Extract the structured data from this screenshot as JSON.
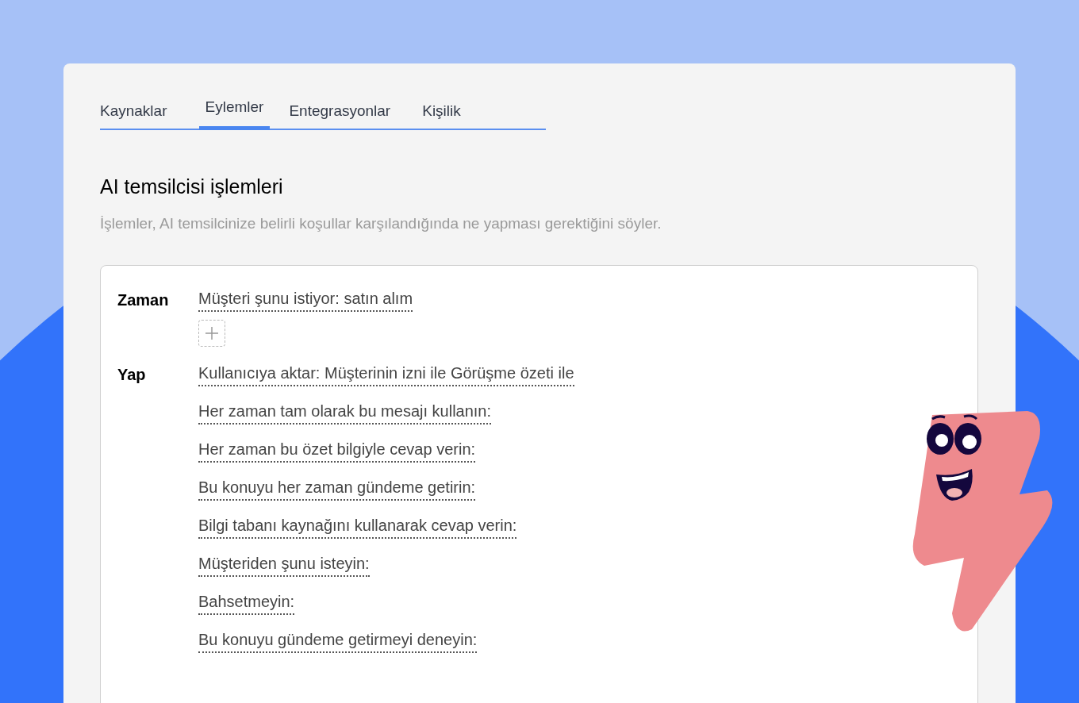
{
  "tabs": [
    {
      "label": "Kaynaklar",
      "selected": false
    },
    {
      "label": "Eylemler",
      "selected": true
    },
    {
      "label": "Entegrasyonlar",
      "selected": false
    },
    {
      "label": "Kişilik",
      "selected": false
    }
  ],
  "heading": "AI temsilcisi işlemleri",
  "description": "İşlemler, AI temsilcinize belirli koşullar karşılandığında ne yapması gerektiğini söyler.",
  "rules": [
    {
      "kind": "when",
      "label": "Zaman",
      "items": [
        "Müşteri şunu istiyor: satın alım"
      ]
    },
    {
      "kind": "do",
      "label": "Yap",
      "items": [
        "Kullanıcıya aktar: Müşterinin izni ile Görüşme özeti ile",
        "Her zaman tam olarak bu mesajı kullanın:",
        "Her zaman bu özet bilgiyle cevap verin:",
        "Bu konuyu her zaman gündeme getirin:",
        "Bilgi tabanı kaynağını kullanarak cevap verin:",
        "Müşteriden şunu isteyin:",
        "Bahsetmeyin:",
        "Bu konuyu gündeme getirmeyi deneyin:"
      ]
    }
  ]
}
